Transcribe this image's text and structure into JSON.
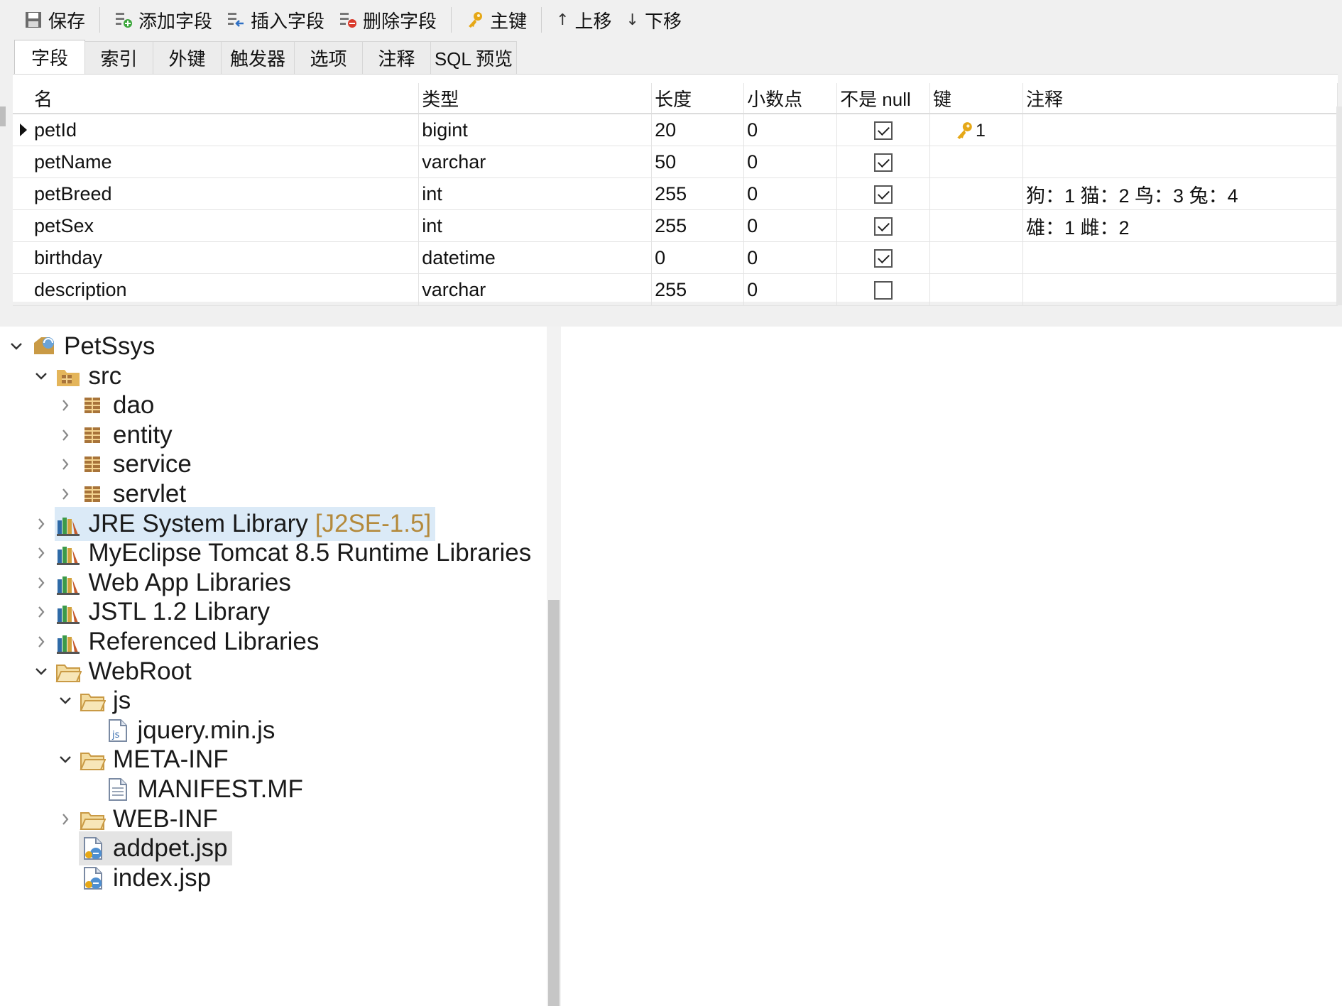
{
  "toolbar": {
    "save": "保存",
    "add_field": "添加字段",
    "insert_field": "插入字段",
    "delete_field": "删除字段",
    "primary_key": "主键",
    "move_up": "上移",
    "move_down": "下移"
  },
  "tabs": [
    "字段",
    "索引",
    "外键",
    "触发器",
    "选项",
    "注释",
    "SQL 预览"
  ],
  "grid": {
    "columns": [
      "名",
      "类型",
      "长度",
      "小数点",
      "不是 null",
      "键",
      "注释"
    ],
    "rows": [
      {
        "name": "petId",
        "type": "bigint",
        "length": "20",
        "decimals": "0",
        "not_null": true,
        "key": "1",
        "comment": ""
      },
      {
        "name": "petName",
        "type": "varchar",
        "length": "50",
        "decimals": "0",
        "not_null": true,
        "key": "",
        "comment": ""
      },
      {
        "name": "petBreed",
        "type": "int",
        "length": "255",
        "decimals": "0",
        "not_null": true,
        "key": "",
        "comment": "狗：1 猫：2 鸟：3 兔：4"
      },
      {
        "name": "petSex",
        "type": "int",
        "length": "255",
        "decimals": "0",
        "not_null": true,
        "key": "",
        "comment": "雄：1 雌：2"
      },
      {
        "name": "birthday",
        "type": "datetime",
        "length": "0",
        "decimals": "0",
        "not_null": true,
        "key": "",
        "comment": ""
      },
      {
        "name": "description",
        "type": "varchar",
        "length": "255",
        "decimals": "0",
        "not_null": false,
        "key": "",
        "comment": ""
      }
    ]
  },
  "tree": {
    "items": [
      {
        "label": "PetSsys",
        "icon": "project-icon",
        "state": "expanded",
        "depth": 0
      },
      {
        "label": "src",
        "icon": "source-folder-icon",
        "state": "expanded",
        "depth": 1
      },
      {
        "label": "dao",
        "icon": "package-icon",
        "state": "collapsed",
        "depth": 2
      },
      {
        "label": "entity",
        "icon": "package-icon",
        "state": "collapsed",
        "depth": 2
      },
      {
        "label": "service",
        "icon": "package-icon",
        "state": "collapsed",
        "depth": 2
      },
      {
        "label": "servlet",
        "icon": "package-icon",
        "state": "collapsed",
        "depth": 2
      },
      {
        "label": "JRE System Library",
        "decoration": "[J2SE-1.5]",
        "icon": "library-icon",
        "state": "collapsed",
        "depth": 1,
        "highlight": "soft"
      },
      {
        "label": "MyEclipse Tomcat 8.5 Runtime Libraries",
        "icon": "library-icon",
        "state": "collapsed",
        "depth": 1
      },
      {
        "label": "Web App Libraries",
        "icon": "library-icon",
        "state": "collapsed",
        "depth": 1
      },
      {
        "label": "JSTL 1.2 Library",
        "icon": "library-icon",
        "state": "collapsed",
        "depth": 1
      },
      {
        "label": "Referenced Libraries",
        "icon": "library-icon",
        "state": "collapsed",
        "depth": 1
      },
      {
        "label": "WebRoot",
        "icon": "folder-icon",
        "state": "expanded",
        "depth": 1
      },
      {
        "label": "js",
        "icon": "folder-icon",
        "state": "expanded",
        "depth": 2
      },
      {
        "label": "jquery.min.js",
        "icon": "js-file-icon",
        "state": "leaf",
        "depth": 3
      },
      {
        "label": "META-INF",
        "icon": "folder-icon",
        "state": "expanded",
        "depth": 2
      },
      {
        "label": "MANIFEST.MF",
        "icon": "text-file-icon",
        "state": "leaf",
        "depth": 3
      },
      {
        "label": "WEB-INF",
        "icon": "folder-icon",
        "state": "collapsed",
        "depth": 2
      },
      {
        "label": "addpet.jsp",
        "icon": "jsp-file-icon",
        "state": "leaf",
        "depth": 2,
        "highlight": "grey"
      },
      {
        "label": "index.jsp",
        "icon": "jsp-file-icon",
        "state": "leaf",
        "depth": 2
      }
    ]
  },
  "colors": {
    "toolbar_bg": "#f0f0f0",
    "selection_soft": "#dbeaf7",
    "selection_grey": "#e4e4e4",
    "key_gold": "#e6a817",
    "decoration_text": "#b48a3c"
  }
}
